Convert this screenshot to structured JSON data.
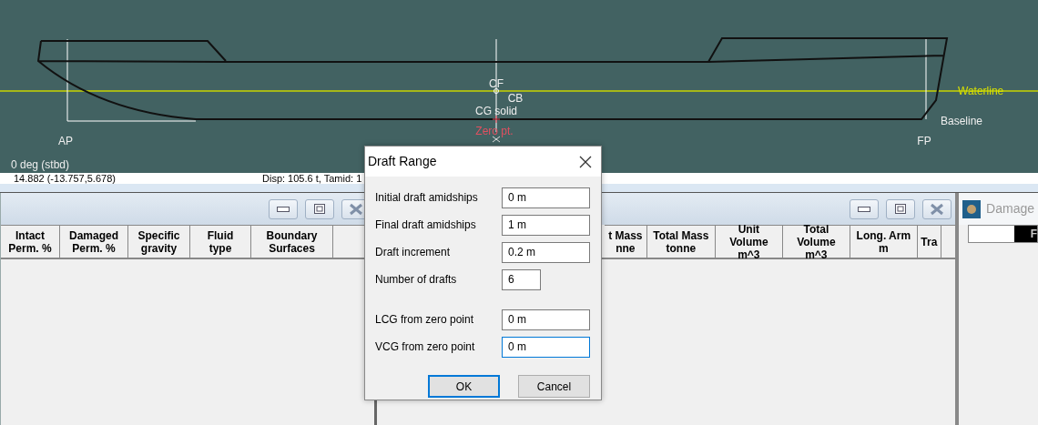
{
  "view": {
    "heel": "0 deg (stbd)",
    "labels": [
      {
        "kind": "station",
        "text": "AP"
      },
      {
        "kind": "station",
        "text": "FP"
      },
      {
        "kind": "point",
        "text": "CF"
      },
      {
        "kind": "point",
        "text": "CG solid"
      },
      {
        "kind": "point",
        "text": "CB"
      },
      {
        "kind": "origin",
        "text": "Zero pt."
      },
      {
        "kind": "waterline",
        "text": "Waterline"
      },
      {
        "kind": "point",
        "text": "Baseline"
      }
    ]
  },
  "status_bar": {
    "position": "14.882 (-13.757,5.678)",
    "displacement": "Disp: 105.6 t, Tamid: 1"
  },
  "left_panel": {
    "columns": [
      [
        "Intact",
        "Perm. %"
      ],
      [
        "Damaged",
        "Perm. %"
      ],
      [
        "Specific",
        "gravity"
      ],
      [
        "Fluid",
        "type"
      ],
      [
        "Boundary",
        "Surfaces"
      ]
    ]
  },
  "middle_panel": {
    "columns": [
      [
        "t Mass",
        "nne"
      ],
      [
        "Total Mass",
        "tonne"
      ],
      [
        "Unit",
        "Volume",
        "m^3"
      ],
      [
        "Total",
        "Volume",
        "m^3"
      ],
      [
        "Long. Arm",
        "m"
      ],
      [
        "Tra"
      ]
    ]
  },
  "right_panel": {
    "title": "Damage",
    "column_1": "F"
  },
  "dialog": {
    "title": "Draft Range",
    "field_groups": [
      [
        {
          "label": "Initial draft amidships",
          "value": "0 m",
          "kind": "wide",
          "focused": false
        },
        {
          "label": "Final draft amidships",
          "value": "1 m",
          "kind": "wide",
          "focused": false
        },
        {
          "label": "Draft increment",
          "value": "0.2 m",
          "kind": "wide",
          "focused": false
        },
        {
          "label": "Number of drafts",
          "value": "6",
          "kind": "narrow",
          "focused": false
        }
      ],
      [
        {
          "label": "LCG from zero point",
          "value": "0 m",
          "kind": "wide",
          "focused": false
        },
        {
          "label": "VCG from zero point",
          "value": "0 m",
          "kind": "wide",
          "focused": true
        }
      ]
    ],
    "buttons": [
      {
        "label": "OK",
        "default": true
      },
      {
        "label": "Cancel",
        "default": false
      }
    ]
  }
}
